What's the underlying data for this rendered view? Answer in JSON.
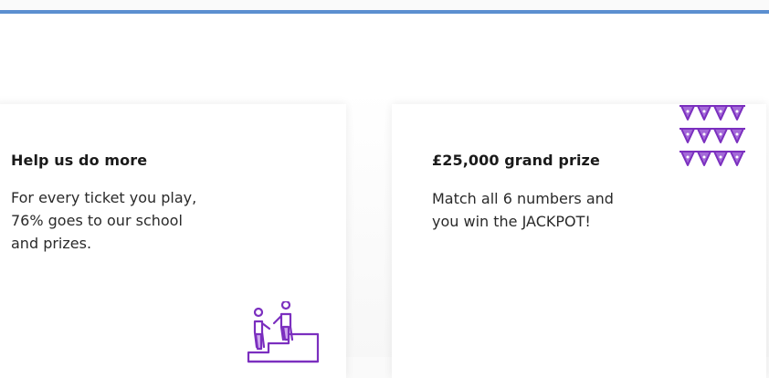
{
  "cards": [
    {
      "title": "Help us do more",
      "body": "For every ticket you play,\n76% goes to our school\nand prizes.",
      "icon": "stairs-people-icon"
    },
    {
      "title": "£25,000 grand prize",
      "body": "Match all 6 numbers and\nyou win the JACKPOT!",
      "icon": "bunting-icon"
    }
  ],
  "colors": {
    "top_rule": "#5b8fd0",
    "icon_purple": "#7b2fbf",
    "bunting_fill": "#a46ad8"
  }
}
